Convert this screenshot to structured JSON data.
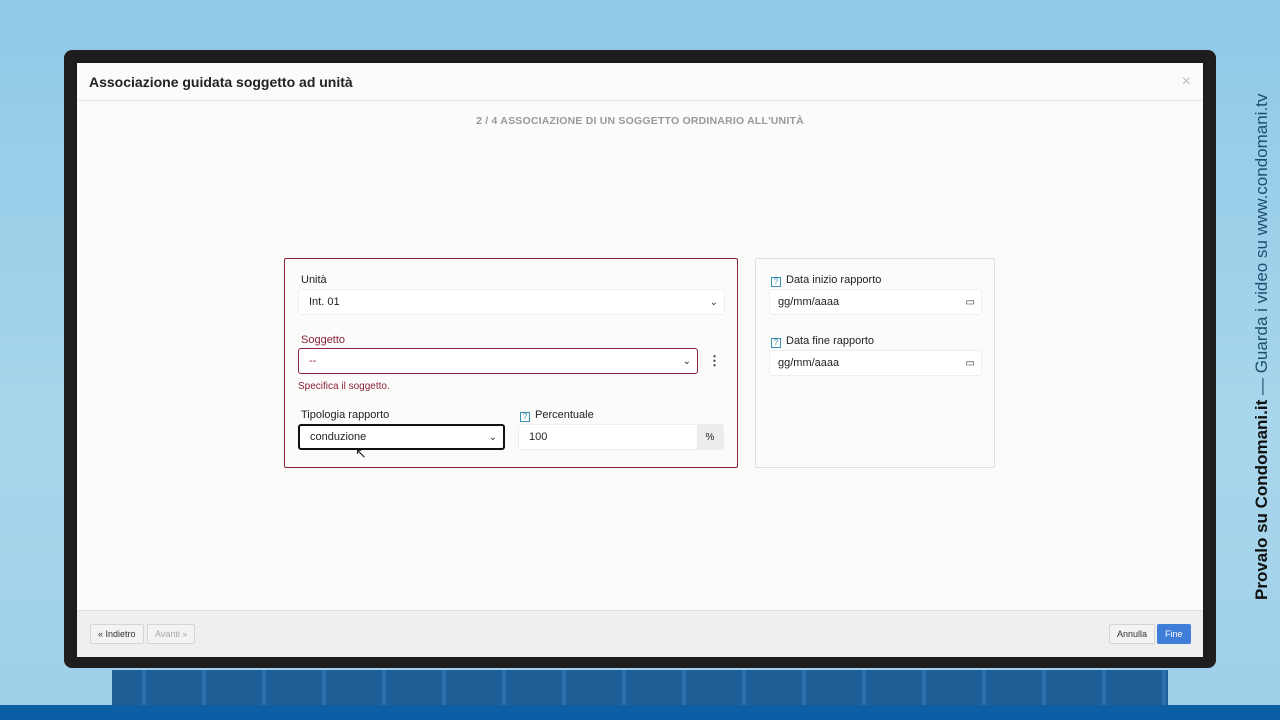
{
  "modal": {
    "title": "Associazione guidata soggetto ad unità",
    "step": "2 / 4 ASSOCIAZIONE DI UN SOGGETTO ORDINARIO ALL'UNITÀ"
  },
  "form": {
    "unita_label": "Unità",
    "unita_value": "Int. 01",
    "soggetto_label": "Soggetto",
    "soggetto_value": "--",
    "soggetto_error": "Specifica il soggetto.",
    "tipologia_label": "Tipologia rapporto",
    "tipologia_value": "conduzione",
    "percentuale_label": "Percentuale",
    "percentuale_value": "100",
    "percentuale_unit": "%",
    "data_inizio_label": "Data inizio rapporto",
    "data_inizio_placeholder": "gg/mm/aaaa",
    "data_fine_label": "Data fine rapporto",
    "data_fine_placeholder": "gg/mm/aaaa"
  },
  "footer": {
    "back": "« Indietro",
    "next": "Avanti »",
    "cancel": "Annulla",
    "finish": "Fine"
  },
  "banner": {
    "bold": "Provalo su Condomani.it",
    "rest": " — Guarda i video su www.condomani.tv"
  },
  "colors": {
    "error": "#8b2240",
    "primary": "#3e7dd8"
  }
}
